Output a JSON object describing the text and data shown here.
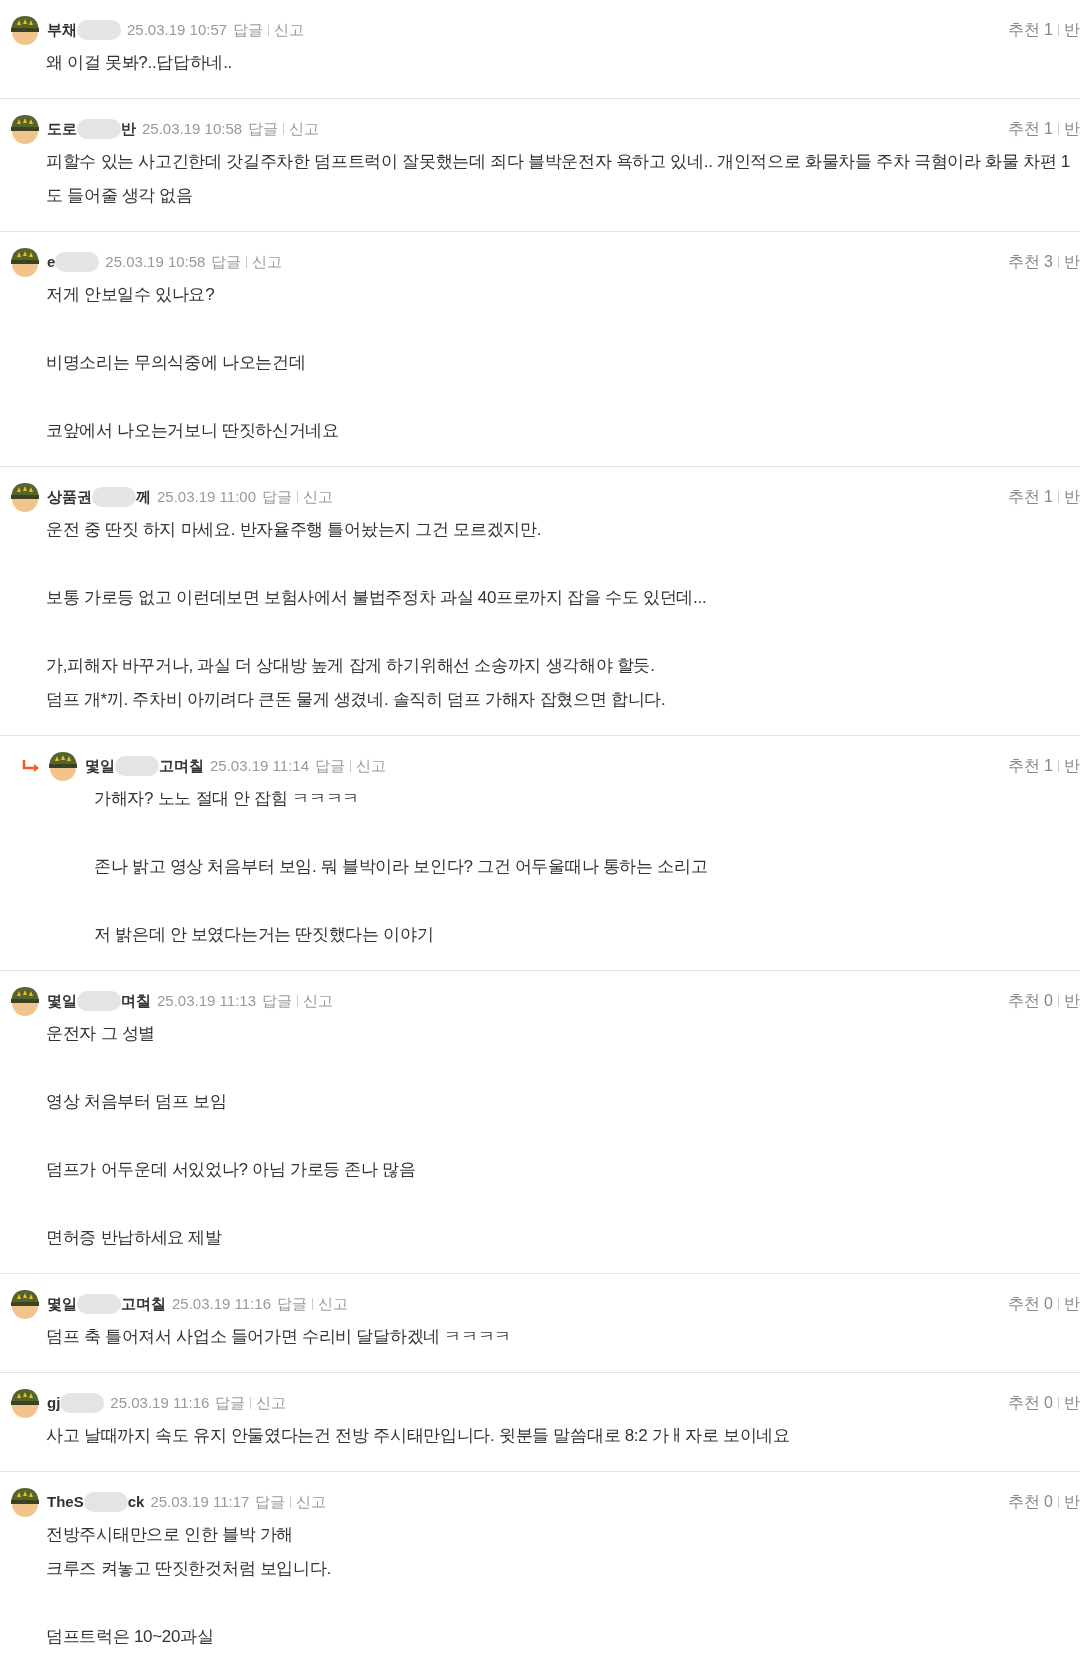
{
  "comments": [
    {
      "reply": false,
      "name_start": "부채",
      "date": "25.03.19 10:57",
      "reply_link": "답글",
      "report_link": "신고",
      "likes": "추천 1",
      "dislike_label": "반",
      "paragraphs": [
        [
          "왜 이걸 못봐?..답답하네.."
        ]
      ]
    },
    {
      "reply": false,
      "name_start": "도로",
      "name_end": "반",
      "date": "25.03.19 10:58",
      "reply_link": "답글",
      "report_link": "신고",
      "likes": "추천 1",
      "dislike_label": "반",
      "paragraphs": [
        [
          "피할수 있는 사고긴한데 갓길주차한 덤프트럭이 잘못했는데 죄다 블박운전자 욕하고 있네.. 개인적으로 화물차들 주차 극혐이라 화물 차편 1도 들어줄 생각 없음"
        ]
      ]
    },
    {
      "reply": false,
      "name_start": "e",
      "date": "25.03.19 10:58",
      "reply_link": "답글",
      "report_link": "신고",
      "likes": "추천 3",
      "dislike_label": "반",
      "paragraphs": [
        [
          "저게 안보일수 있나요?"
        ],
        [
          "비명소리는 무의식중에 나오는건데"
        ],
        [
          "코앞에서 나오는거보니 딴짓하신거네요"
        ]
      ]
    },
    {
      "reply": false,
      "name_start": "상품권",
      "name_end": "께",
      "date": "25.03.19 11:00",
      "reply_link": "답글",
      "report_link": "신고",
      "likes": "추천 1",
      "dislike_label": "반",
      "paragraphs": [
        [
          "운전 중 딴짓 하지 마세요. 반자율주행 틀어놨는지 그건 모르겠지만."
        ],
        [
          "보통 가로등 없고 이런데보면 보험사에서 불법주정차 과실 40프로까지 잡을 수도 있던데..."
        ],
        [
          "가,피해자 바꾸거나, 과실 더 상대방 높게 잡게 하기위해선 소송까지 생각해야 할듯.",
          "덤프 개*끼. 주차비 아끼려다 큰돈 물게 생겼네. 솔직히 덤프 가해자 잡혔으면 합니다."
        ]
      ]
    },
    {
      "reply": true,
      "name_start": "몇일",
      "name_end": "고며칠",
      "date": "25.03.19 11:14",
      "reply_link": "답글",
      "report_link": "신고",
      "likes": "추천 1",
      "dislike_label": "반",
      "paragraphs": [
        [
          "가해자? 노노 절대 안 잡힘 ㅋㅋㅋㅋ"
        ],
        [
          "존나 밝고 영상 처음부터 보임. 뭐 블박이라 보인다? 그건 어두울때나 통하는 소리고"
        ],
        [
          "저 밝은데 안 보였다는거는 딴짓했다는 이야기"
        ]
      ]
    },
    {
      "reply": false,
      "name_start": "몇일",
      "name_end": "며칠",
      "date": "25.03.19 11:13",
      "reply_link": "답글",
      "report_link": "신고",
      "likes": "추천 0",
      "dislike_label": "반",
      "paragraphs": [
        [
          "운전자 그 성별"
        ],
        [
          "영상 처음부터 덤프 보임"
        ],
        [
          "덤프가 어두운데 서있었나? 아님 가로등 존나 많음"
        ],
        [
          "면허증 반납하세요 제발"
        ]
      ]
    },
    {
      "reply": false,
      "name_start": "몇일",
      "name_end": "고며칠",
      "date": "25.03.19 11:16",
      "reply_link": "답글",
      "report_link": "신고",
      "likes": "추천 0",
      "dislike_label": "반",
      "paragraphs": [
        [
          "덤프 축 틀어져서 사업소 들어가면 수리비 달달하겠네 ㅋㅋㅋㅋ"
        ]
      ]
    },
    {
      "reply": false,
      "name_start": "gj",
      "date": "25.03.19 11:16",
      "reply_link": "답글",
      "report_link": "신고",
      "likes": "추천 0",
      "dislike_label": "반",
      "paragraphs": [
        [
          "사고 날때까지 속도 유지 안둘였다는건 전방 주시태만입니다. 윗분들 말씀대로 8:2 가ㅐ자로 보이네요"
        ]
      ]
    },
    {
      "reply": false,
      "name_start": "TheS",
      "name_end": "ck",
      "date": "25.03.19 11:17",
      "reply_link": "답글",
      "report_link": "신고",
      "likes": "추천 0",
      "dislike_label": "반",
      "paragraphs": [
        [
          "전방주시태만으로 인한 블박 가해",
          "크루즈 켜놓고 딴짓한것처럼 보입니다."
        ],
        [
          "덤프트럭은 10~20과실"
        ]
      ]
    }
  ]
}
